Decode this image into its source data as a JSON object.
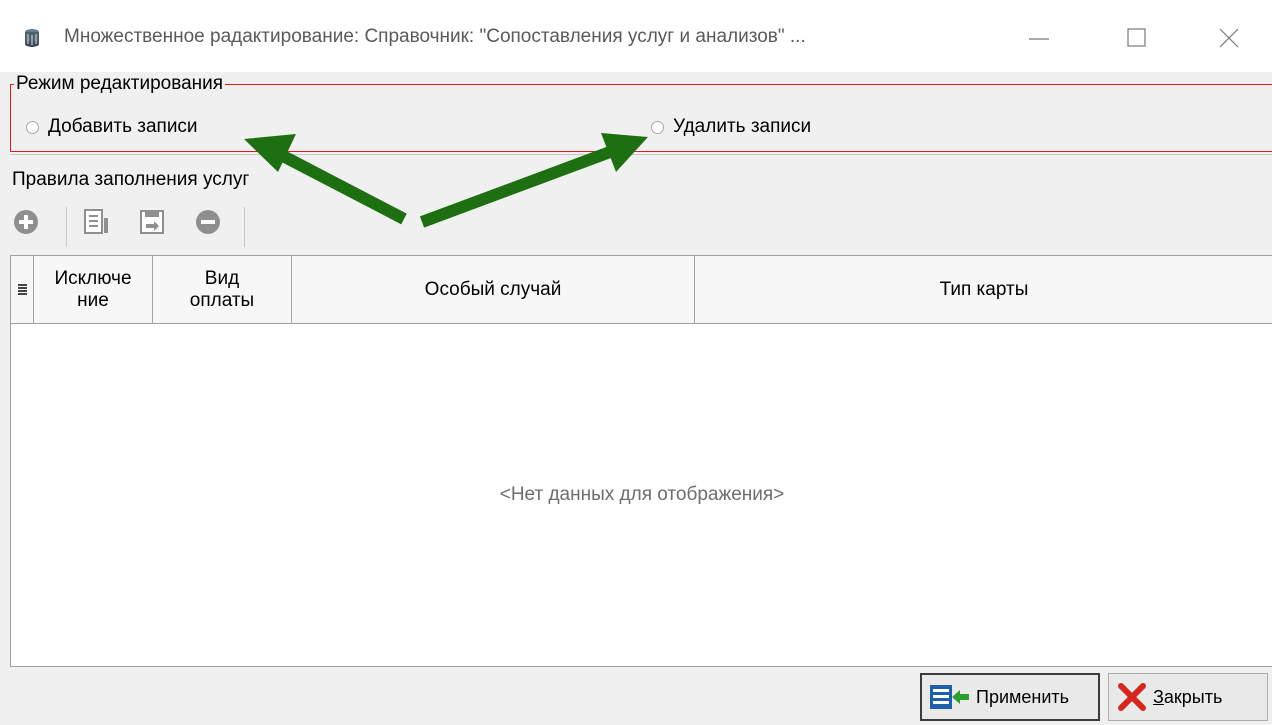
{
  "window": {
    "title": "Множественное радактирование: Справочник: \"Сопоставления услуг и анализов\" ...",
    "icon": "database-icon",
    "controls": [
      "minimize-icon",
      "maximize-icon",
      "close-icon"
    ]
  },
  "edit_mode": {
    "legend": "Режим редактирования",
    "options": [
      {
        "label": "Добавить записи",
        "selected": false
      },
      {
        "label": "Удалить записи",
        "selected": false
      }
    ]
  },
  "rules": {
    "section_title": "Правила заполнения услуг",
    "toolbar": [
      "add-icon",
      "edit-icon",
      "save-icon",
      "remove-icon"
    ]
  },
  "grid": {
    "columns": [
      "Исключе\nние",
      "Вид\nоплаты",
      "Особый случай",
      "Тип карты"
    ],
    "empty_text": "<Нет данных для отображения>"
  },
  "buttons": {
    "apply": "Применить",
    "close_first": "З",
    "close_rest": "акрыть"
  },
  "colors": {
    "group_border": "#e01b1b",
    "arrow": "#1e6f12"
  }
}
